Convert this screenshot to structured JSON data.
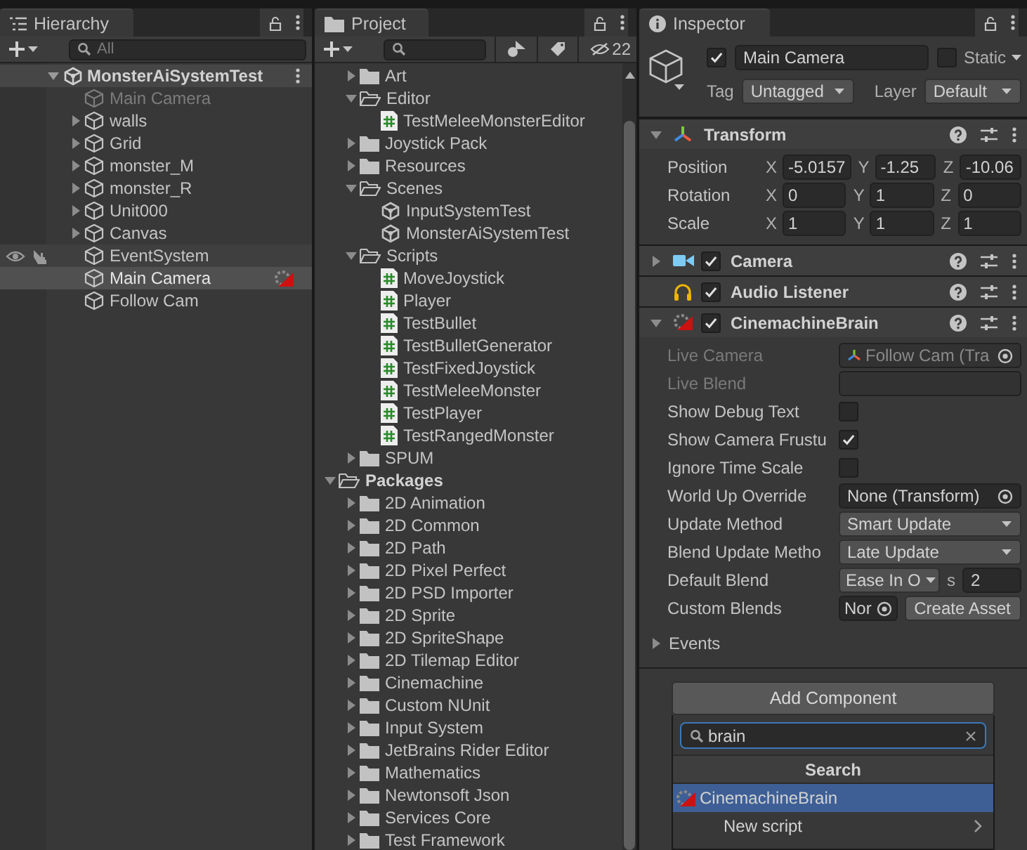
{
  "hierarchy": {
    "title": "Hierarchy",
    "search": {
      "placeholder": "All"
    },
    "scene": {
      "name": "MonsterAiSystemTest",
      "expanded": true,
      "children": [
        {
          "name": "Main Camera",
          "kind": "object",
          "active": false,
          "selected": false,
          "hovered": false,
          "component_icon": false
        },
        {
          "name": "walls",
          "kind": "parent",
          "expanded": false,
          "active": true,
          "selected": false,
          "hovered": false,
          "component_icon": false
        },
        {
          "name": "Grid",
          "kind": "parent",
          "expanded": false,
          "active": true,
          "selected": false,
          "hovered": false,
          "component_icon": false
        },
        {
          "name": "monster_M",
          "kind": "parent",
          "expanded": false,
          "active": true,
          "selected": false,
          "hovered": false,
          "component_icon": false
        },
        {
          "name": "monster_R",
          "kind": "parent",
          "expanded": false,
          "active": true,
          "selected": false,
          "hovered": false,
          "component_icon": false
        },
        {
          "name": "Unit000",
          "kind": "parent",
          "expanded": false,
          "active": true,
          "selected": false,
          "hovered": false,
          "component_icon": false
        },
        {
          "name": "Canvas",
          "kind": "parent",
          "expanded": false,
          "active": true,
          "selected": false,
          "hovered": false,
          "component_icon": false
        },
        {
          "name": "EventSystem",
          "kind": "object",
          "active": true,
          "selected": false,
          "hovered": true,
          "component_icon": false
        },
        {
          "name": "Main Camera",
          "kind": "object",
          "active": true,
          "selected": true,
          "hovered": false,
          "component_icon": true
        },
        {
          "name": "Follow Cam",
          "kind": "object",
          "active": true,
          "selected": false,
          "hovered": false,
          "component_icon": false
        }
      ]
    }
  },
  "project": {
    "title": "Project",
    "hidden_count": "22",
    "assets_children": [
      {
        "name": "Art",
        "kind": "folder",
        "expanded": false
      },
      {
        "name": "Editor",
        "kind": "folder",
        "expanded": true,
        "children": [
          {
            "name": "TestMeleeMonsterEditor",
            "kind": "script"
          }
        ]
      },
      {
        "name": "Joystick Pack",
        "kind": "folder",
        "expanded": false
      },
      {
        "name": "Resources",
        "kind": "folder",
        "expanded": false
      },
      {
        "name": "Scenes",
        "kind": "folder",
        "expanded": true,
        "children": [
          {
            "name": "InputSystemTest",
            "kind": "scene"
          },
          {
            "name": "MonsterAiSystemTest",
            "kind": "scene"
          }
        ]
      },
      {
        "name": "Scripts",
        "kind": "folder",
        "expanded": true,
        "children": [
          {
            "name": "MoveJoystick",
            "kind": "script"
          },
          {
            "name": "Player",
            "kind": "script"
          },
          {
            "name": "TestBullet",
            "kind": "script"
          },
          {
            "name": "TestBulletGenerator",
            "kind": "script"
          },
          {
            "name": "TestFixedJoystick",
            "kind": "script"
          },
          {
            "name": "TestMeleeMonster",
            "kind": "script"
          },
          {
            "name": "TestPlayer",
            "kind": "script"
          },
          {
            "name": "TestRangedMonster",
            "kind": "script"
          }
        ]
      },
      {
        "name": "SPUM",
        "kind": "folder",
        "expanded": false
      }
    ],
    "packages": {
      "name": "Packages",
      "kind": "folder",
      "expanded": true,
      "children": [
        {
          "name": "2D Animation",
          "kind": "folder",
          "expanded": false
        },
        {
          "name": "2D Common",
          "kind": "folder",
          "expanded": false
        },
        {
          "name": "2D Path",
          "kind": "folder",
          "expanded": false
        },
        {
          "name": "2D Pixel Perfect",
          "kind": "folder",
          "expanded": false
        },
        {
          "name": "2D PSD Importer",
          "kind": "folder",
          "expanded": false
        },
        {
          "name": "2D Sprite",
          "kind": "folder",
          "expanded": false
        },
        {
          "name": "2D SpriteShape",
          "kind": "folder",
          "expanded": false
        },
        {
          "name": "2D Tilemap Editor",
          "kind": "folder",
          "expanded": false
        },
        {
          "name": "Cinemachine",
          "kind": "folder",
          "expanded": false
        },
        {
          "name": "Custom NUnit",
          "kind": "folder",
          "expanded": false
        },
        {
          "name": "Input System",
          "kind": "folder",
          "expanded": false
        },
        {
          "name": "JetBrains Rider Editor",
          "kind": "folder",
          "expanded": false
        },
        {
          "name": "Mathematics",
          "kind": "folder",
          "expanded": false
        },
        {
          "name": "Newtonsoft Json",
          "kind": "folder",
          "expanded": false
        },
        {
          "name": "Services Core",
          "kind": "folder",
          "expanded": false
        },
        {
          "name": "Test Framework",
          "kind": "folder",
          "expanded": false
        }
      ]
    }
  },
  "inspector": {
    "title": "Inspector",
    "object": {
      "active": true,
      "name": "Main Camera",
      "static": false,
      "static_label": "Static",
      "tag_label": "Tag",
      "tag": "Untagged",
      "layer_label": "Layer",
      "layer": "Default"
    },
    "components": [
      {
        "kind": "transform",
        "name": "Transform",
        "expanded": true,
        "rows": [
          {
            "label": "Position",
            "values": [
              {
                "axis": "X",
                "value": "-5.0157"
              },
              {
                "axis": "Y",
                "value": "-1.25"
              },
              {
                "axis": "Z",
                "value": "-10.06"
              }
            ]
          },
          {
            "label": "Rotation",
            "values": [
              {
                "axis": "X",
                "value": "0"
              },
              {
                "axis": "Y",
                "value": "1"
              },
              {
                "axis": "Z",
                "value": "0"
              }
            ]
          },
          {
            "label": "Scale",
            "values": [
              {
                "axis": "X",
                "value": "1"
              },
              {
                "axis": "Y",
                "value": "1"
              },
              {
                "axis": "Z",
                "value": "1"
              }
            ]
          }
        ]
      },
      {
        "kind": "camera",
        "name": "Camera",
        "expanded": false,
        "enabled": true
      },
      {
        "kind": "audio",
        "name": "Audio Listener",
        "enabled": true
      },
      {
        "kind": "brain",
        "name": "CinemachineBrain",
        "expanded": true,
        "enabled": true,
        "properties": [
          {
            "label": "Live Camera",
            "kind": "object",
            "value": "Follow Cam (Tra",
            "disabled": true
          },
          {
            "label": "Live Blend",
            "kind": "text",
            "disabled": true
          },
          {
            "label": "Show Debug Text",
            "kind": "toggle",
            "checked": false,
            "disabled": false
          },
          {
            "label": "Show Camera Frustu",
            "kind": "toggle",
            "checked": true,
            "disabled": false
          },
          {
            "label": "Ignore Time Scale",
            "kind": "toggle",
            "checked": false,
            "disabled": false
          },
          {
            "label": "World Up Override",
            "kind": "object",
            "value": "None (Transform)",
            "disabled": false
          },
          {
            "label": "Update Method",
            "kind": "dropdown",
            "value": "Smart Update",
            "disabled": false
          },
          {
            "label": "Blend Update Metho",
            "kind": "dropdown",
            "value": "Late Update",
            "disabled": false
          },
          {
            "label": "Default Blend",
            "kind": "blend",
            "value": "Ease In O",
            "unit": "s",
            "amount": "2",
            "disabled": false
          },
          {
            "label": "Custom Blends",
            "kind": "asset",
            "value": "Nor",
            "button": "Create Asset",
            "disabled": false
          }
        ]
      }
    ],
    "events": {
      "label": "Events",
      "expanded": false
    },
    "add_component": {
      "button": "Add Component",
      "search": {
        "value": "brain"
      },
      "header": "Search",
      "results": [
        {
          "label": "CinemachineBrain",
          "kind": "component",
          "selected": true
        },
        {
          "label": "New script",
          "kind": "submenu",
          "selected": false
        }
      ]
    }
  }
}
